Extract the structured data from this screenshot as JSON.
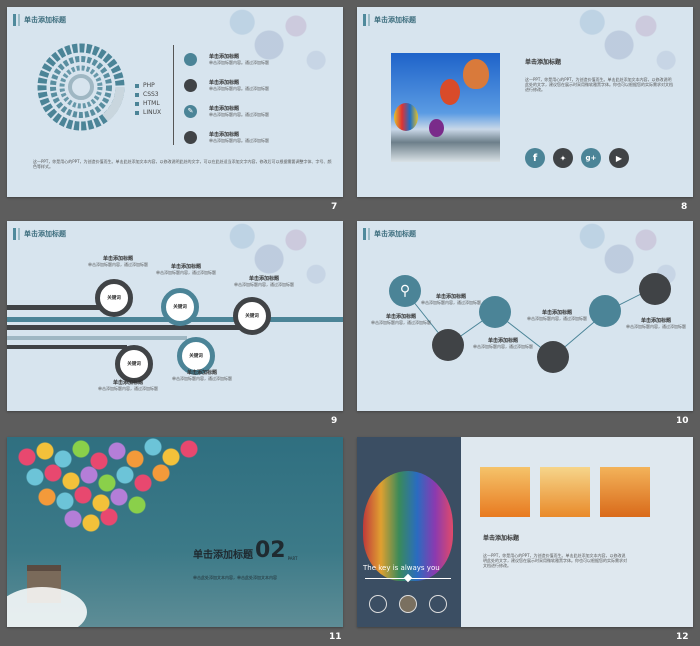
{
  "slides": [
    {
      "number": "7",
      "header": "单击添加标题",
      "legend": [
        "PHP",
        "CSS3",
        "HTML",
        "LINUX"
      ],
      "items": [
        {
          "title": "单击添加标题",
          "text": "单击添加标题内容。通过添加标题",
          "icon": "circle-icon",
          "color": "#4b8497"
        },
        {
          "title": "单击添加标题",
          "text": "单击添加标题内容。通过添加标题",
          "icon": "circle-icon",
          "color": "#404346"
        },
        {
          "title": "单击添加标题",
          "text": "单击添加标题内容。通过添加标题",
          "icon": "wrench-icon",
          "color": "#4b8497"
        },
        {
          "title": "单击添加标题",
          "text": "单击添加标题内容。通过添加标题",
          "icon": "circle-icon",
          "color": "#404346"
        }
      ],
      "body": "这一PPT，你是用心的PPT，为创造价值而生。单击此处添加文本内容，以修改说明此处的文字，可以在此处适当添加文字内容，修改后可以根据需要调整字体、字号、颜色等样式。"
    },
    {
      "number": "8",
      "header": "单击添加标题",
      "title": "单击添加标题",
      "body": "这一PPT，你是用心的PPT，为创造价值而生。单击此处添加文本内容，以修改说明此处的文字，建议您在展示时采用微软雅黑字体。你也可以根据您的实际需求对文档进行修改。",
      "social": [
        "facebook-icon",
        "twitter-icon",
        "google-plus-icon",
        "play-icon"
      ]
    },
    {
      "number": "9",
      "header": "单击添加标题",
      "key": "关键词",
      "item_title": "单击添加标题",
      "item_text": "单击添加标题内容，通过添加标题"
    },
    {
      "number": "10",
      "header": "单击添加标题",
      "item_title": "单击添加标题",
      "item_text": "单击添加标题内容，通过添加标题"
    },
    {
      "number": "11",
      "title": "单击添加标题",
      "big": "02",
      "part": "PART",
      "body": "单击此处添加文本内容，单击此处添加文本内容"
    },
    {
      "number": "12",
      "banner": "The key is always you",
      "title": "单击添加标题",
      "body": "这一PPT，你是用心的PPT，为创造价值而生。单击此处添加文本内容，以修改说明此处的文字，建议您在展示时采用微软雅黑字体。你也可以根据您的实际需求对文档进行修改。"
    }
  ]
}
